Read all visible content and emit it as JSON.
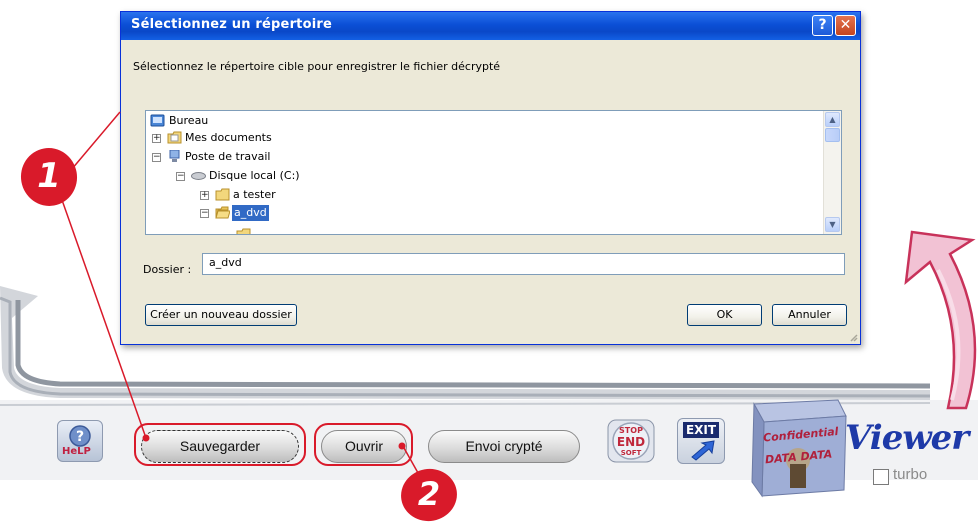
{
  "dialog": {
    "title": "Sélectionnez un répertoire",
    "help_button": "?",
    "close_button": "✕",
    "prompt": "Sélectionnez le répertoire cible pour enregistrer le fichier décrypté",
    "tree": [
      {
        "label": "Bureau"
      },
      {
        "label": "Mes documents"
      },
      {
        "label": "Poste de travail"
      },
      {
        "label": "Disque local (C:)"
      },
      {
        "label": "a tester"
      },
      {
        "label": "a_dvd",
        "selected": true
      }
    ],
    "folder_label": "Dossier :",
    "folder_value": "a_dvd",
    "new_folder_button": "Créer un nouveau dossier",
    "ok_button": "OK",
    "cancel_button": "Annuler"
  },
  "toolbar": {
    "save_button": "Sauvegarder",
    "open_button": "Ouvrir",
    "encrypted_send_button": "Envoi crypté",
    "help_icon_label": "HeLP",
    "stop_icon_lines": [
      "STOP",
      "END",
      "SOFT"
    ],
    "exit_icon_label": "EXIT",
    "brand_name": "Viewer",
    "brand_sub": "turbo",
    "box_label": "Confidential DATA DATA"
  },
  "callouts": [
    "1",
    "2"
  ],
  "colors": {
    "titlebar": "#0a48c8",
    "selection": "#316ac5",
    "callout_red": "#d91a2a",
    "frame_gray": "#9aa0aa",
    "brand_blue": "#1e3aa8"
  }
}
